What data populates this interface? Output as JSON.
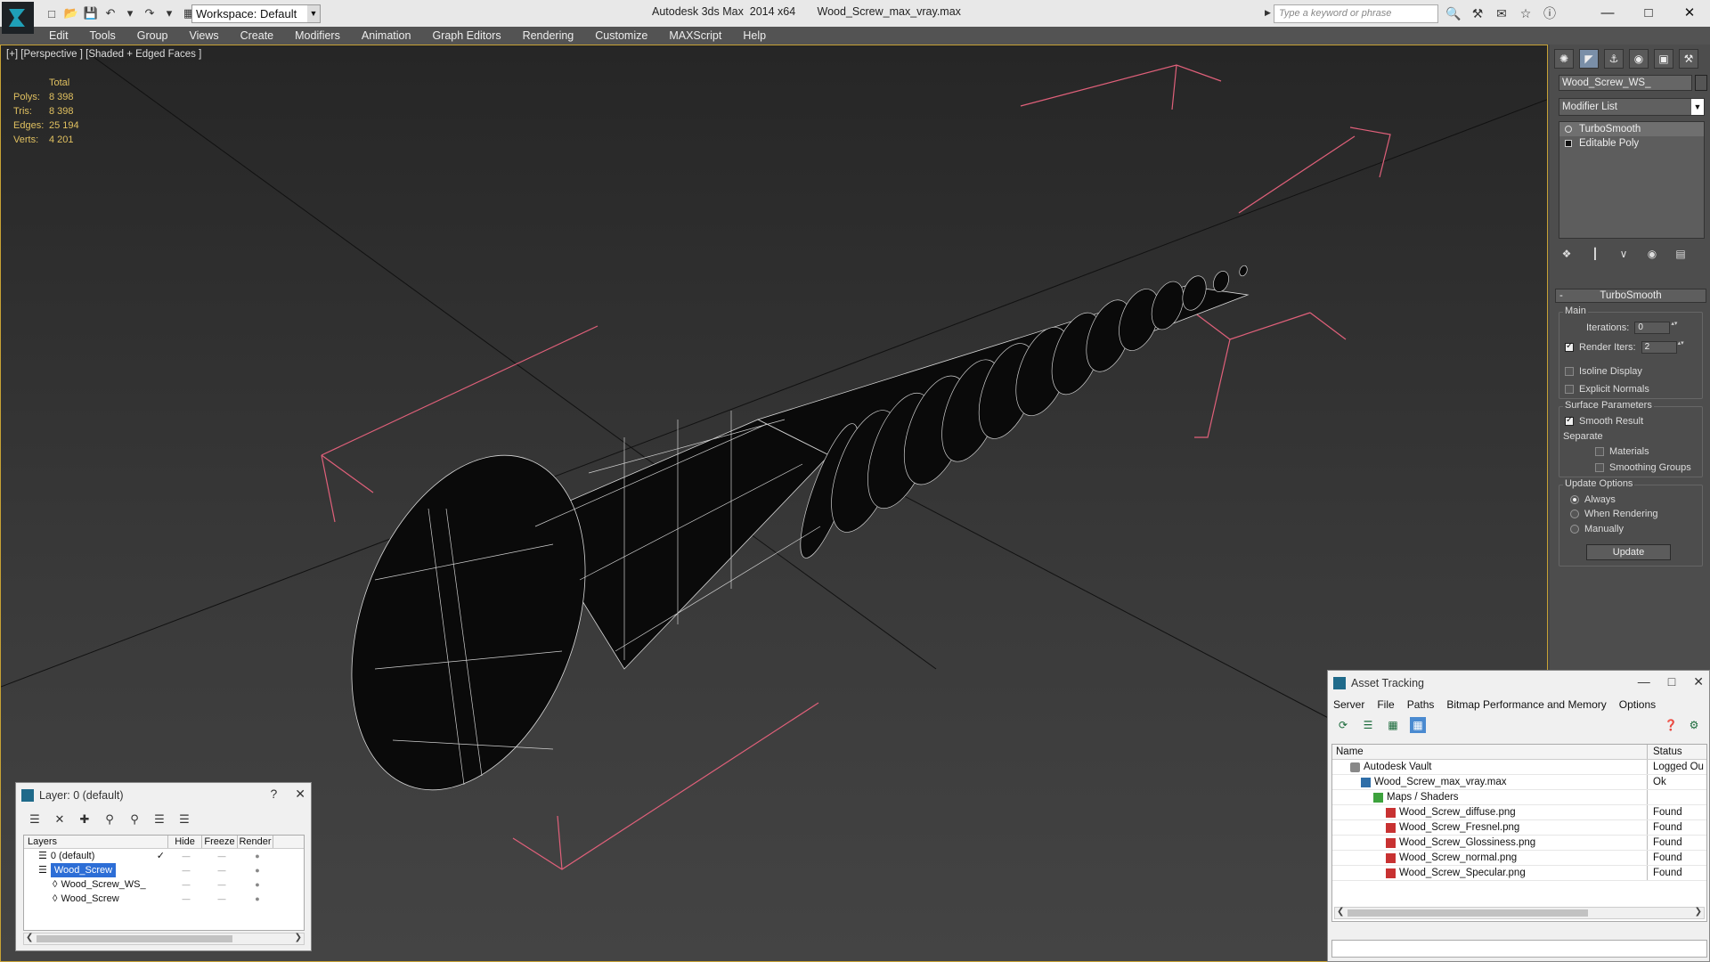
{
  "titlebar": {
    "workspace": "Workspace: Default",
    "title": "Autodesk 3ds Max  2014 x64       Wood_Screw_max_vray.max",
    "search_placeholder": "Type a keyword or phrase"
  },
  "menu": [
    "Edit",
    "Tools",
    "Group",
    "Views",
    "Create",
    "Modifiers",
    "Animation",
    "Graph Editors",
    "Rendering",
    "Customize",
    "MAXScript",
    "Help"
  ],
  "viewport": {
    "label": "[+] [Perspective ] [Shaded + Edged Faces ]",
    "stats": {
      "header": "Total",
      "rows": [
        {
          "k": "Polys:",
          "v": "8 398"
        },
        {
          "k": "Tris:",
          "v": "8 398"
        },
        {
          "k": "Edges:",
          "v": "25 194"
        },
        {
          "k": "Verts:",
          "v": "4 201"
        }
      ]
    }
  },
  "command_panel": {
    "object_name": "Wood_Screw_WS_",
    "modifier_list": "Modifier List",
    "stack": [
      "TurboSmooth",
      "Editable Poly"
    ],
    "rollout_title": "TurboSmooth",
    "main_group": "Main",
    "iterations_label": "Iterations:",
    "iterations_value": "0",
    "render_iters_label": "Render Iters:",
    "render_iters_value": "2",
    "isoline": "Isoline Display",
    "explicit_normals": "Explicit Normals",
    "surface_group": "Surface Parameters",
    "smooth_result": "Smooth Result",
    "separate": "Separate",
    "materials": "Materials",
    "smoothing_groups": "Smoothing Groups",
    "update_group": "Update Options",
    "always": "Always",
    "when_rendering": "When Rendering",
    "manually": "Manually",
    "update_button": "Update"
  },
  "asset_tracking": {
    "title": "Asset Tracking",
    "menu": [
      "Server",
      "File",
      "Paths",
      "Bitmap Performance and Memory",
      "Options"
    ],
    "col_name": "Name",
    "col_status": "Status",
    "rows": [
      {
        "name": "Autodesk Vault",
        "status": "Logged Ou",
        "indent": 0,
        "icon": "vault"
      },
      {
        "name": "Wood_Screw_max_vray.max",
        "status": "Ok",
        "indent": 1,
        "icon": "max"
      },
      {
        "name": "Maps / Shaders",
        "status": "",
        "indent": 2,
        "icon": "folder"
      },
      {
        "name": "Wood_Screw_diffuse.png",
        "status": "Found",
        "indent": 3,
        "icon": "png"
      },
      {
        "name": "Wood_Screw_Fresnel.png",
        "status": "Found",
        "indent": 3,
        "icon": "png"
      },
      {
        "name": "Wood_Screw_Glossiness.png",
        "status": "Found",
        "indent": 3,
        "icon": "png"
      },
      {
        "name": "Wood_Screw_normal.png",
        "status": "Found",
        "indent": 3,
        "icon": "png"
      },
      {
        "name": "Wood_Screw_Specular.png",
        "status": "Found",
        "indent": 3,
        "icon": "png"
      }
    ]
  },
  "layer_window": {
    "title": "Layer: 0 (default)",
    "col_layers": "Layers",
    "col_hide": "Hide",
    "col_freeze": "Freeze",
    "col_render": "Render",
    "rows": [
      {
        "name": "0 (default)",
        "indent": 1
      },
      {
        "name": "Wood_Screw",
        "indent": 1
      },
      {
        "name": "Wood_Screw_WS_",
        "indent": 2
      },
      {
        "name": "Wood_Screw",
        "indent": 2
      }
    ]
  },
  "colors": {
    "accent": "#c7a235",
    "selection": "#2d6ed6",
    "bbox": "#e0607a"
  }
}
